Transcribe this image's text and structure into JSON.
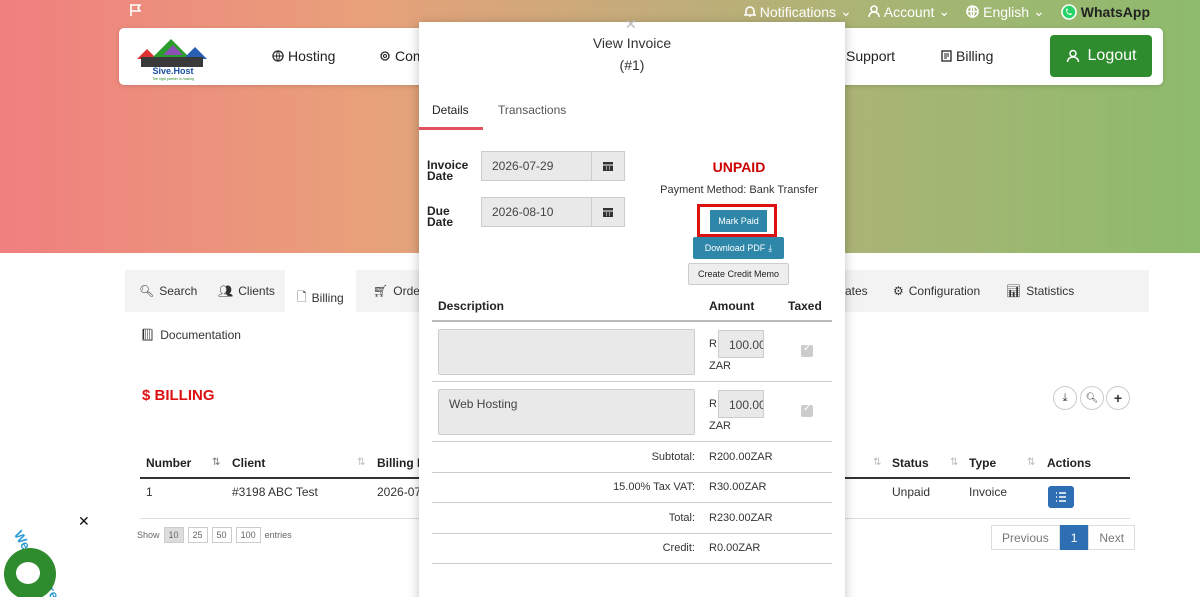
{
  "topbar": {
    "notifications": "Notifications",
    "account": "Account",
    "language": "English",
    "whatsapp": "WhatsApp"
  },
  "brand": {
    "name": "Sive.Host",
    "tagline": "The right partner in hosting"
  },
  "nav": {
    "hosting": "Hosting",
    "community": "Com",
    "support": "Support",
    "billing": "Billing",
    "logout": "Logout"
  },
  "admin_tabs": {
    "search": "Search",
    "clients": "Clients",
    "billing": "Billing",
    "orders": "Order",
    "templates": "ates",
    "configuration": "Configuration",
    "statistics": "Statistics",
    "documentation": "Documentation"
  },
  "billing_section": {
    "title": "$ BILLING",
    "headers": [
      "Number",
      "Client",
      "Billing D",
      "Status",
      "Type",
      "Actions"
    ],
    "row": {
      "number": "1",
      "client": "#3198 ABC Test",
      "billing_date": "2026-07",
      "status": "Unpaid",
      "type": "Invoice"
    },
    "show_label": "Show",
    "page_sizes": [
      "10",
      "25",
      "50",
      "100"
    ],
    "entries_label": "entries",
    "pager": {
      "previous": "Previous",
      "current": "1",
      "next": "Next"
    }
  },
  "chat": {
    "text": "We Are Here!"
  },
  "modal": {
    "title": "View Invoice",
    "number": "(#1)",
    "tabs": {
      "details": "Details",
      "transactions": "Transactions"
    },
    "invoice_date_label": "Invoice Date",
    "invoice_date": "2026-07-29",
    "due_date_label": "Due Date",
    "due_date": "2026-08-10",
    "status": "UNPAID",
    "payment_method": "Payment Method: Bank Transfer",
    "mark_paid": "Mark Paid",
    "download_pdf": "Download PDF",
    "credit_memo": "Create Credit Memo",
    "table_headers": {
      "description": "Description",
      "amount": "Amount",
      "taxed": "Taxed"
    },
    "items": [
      {
        "description": "",
        "currency_symbol": "R",
        "amount": "100.00",
        "currency": "ZAR"
      },
      {
        "description": "Web Hosting",
        "currency_symbol": "R",
        "amount": "100.00",
        "currency": "ZAR"
      }
    ],
    "totals": {
      "subtotal_label": "Subtotal:",
      "subtotal": "R200.00ZAR",
      "tax_label": "15.00% Tax VAT:",
      "tax": "R30.00ZAR",
      "total_label": "Total:",
      "total": "R230.00ZAR",
      "credit_label": "Credit:",
      "credit": "R0.00ZAR"
    }
  },
  "colors": {
    "brand_green": "#2e8b2e",
    "status_red": "#cc0000",
    "button_teal": "#2e87a8",
    "highlight_red": "#dd1111"
  }
}
